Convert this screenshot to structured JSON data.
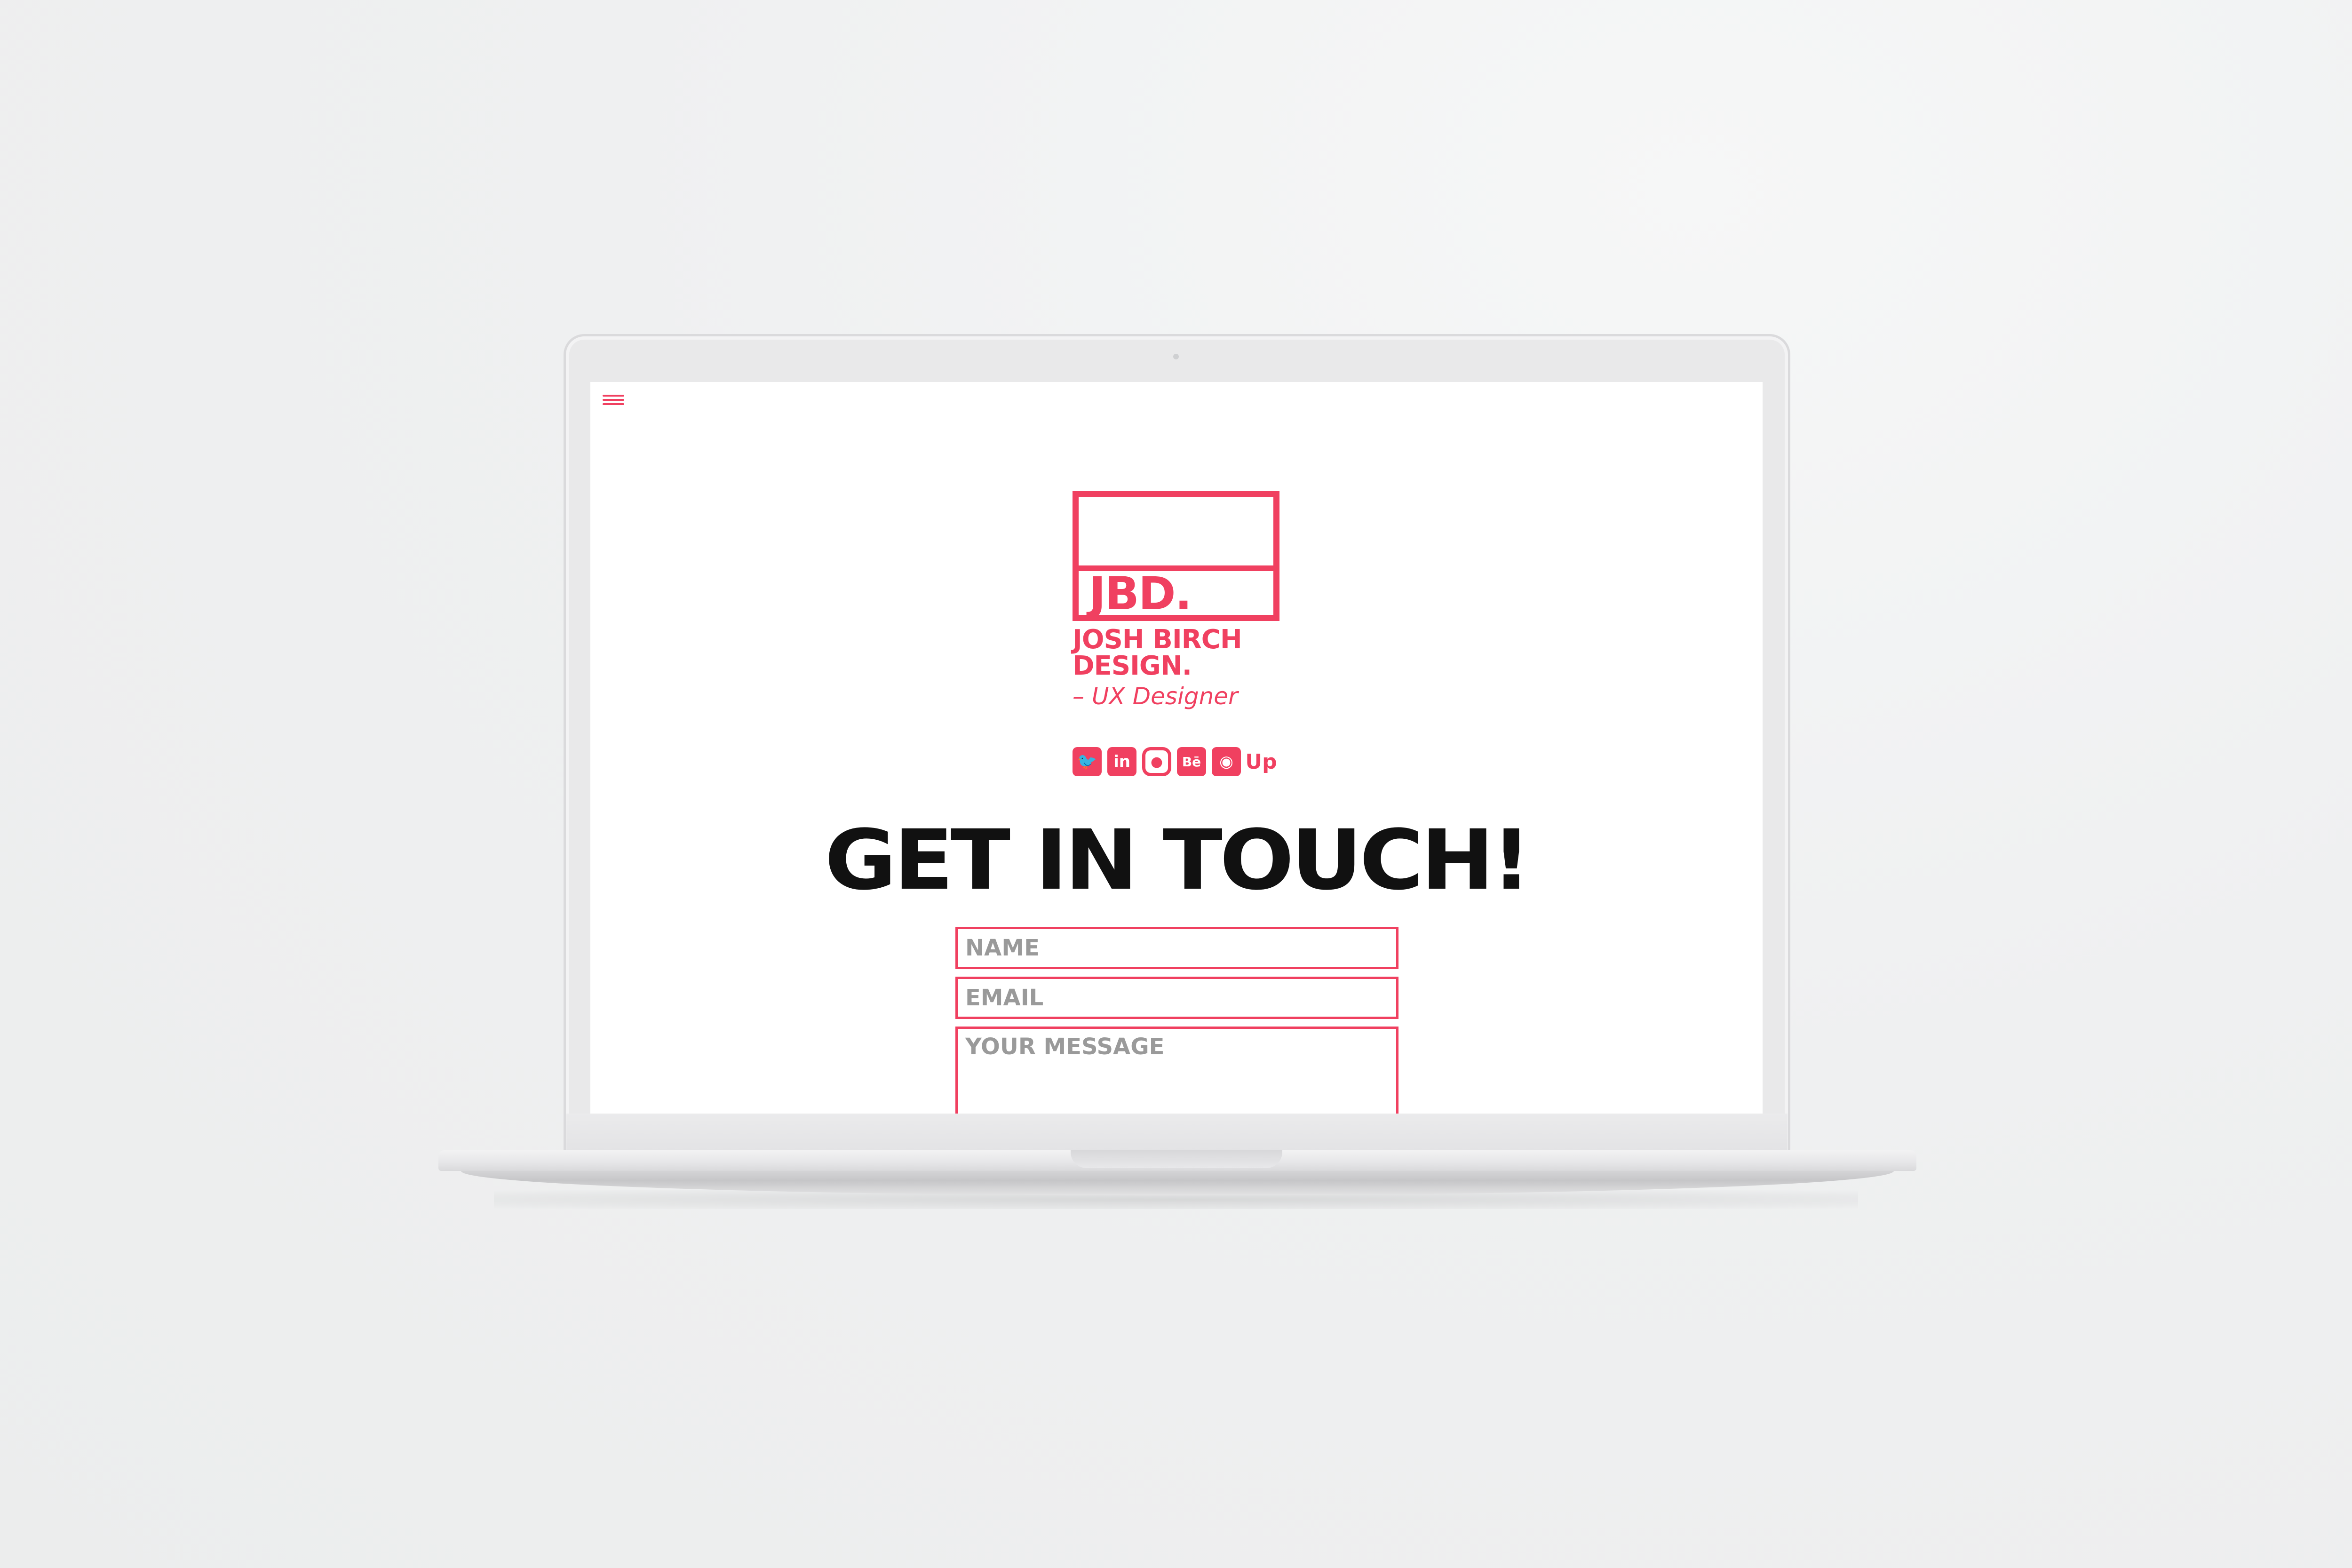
{
  "site": {
    "menu_icon": "hamburger-menu-icon",
    "logo": {
      "mark": "JBD.",
      "name_line1": "JOSH BIRCH",
      "name_line2": "DESIGN.",
      "tagline": "– UX Designer"
    },
    "social": [
      {
        "icon": "twitter-icon",
        "glyph": "🐦"
      },
      {
        "icon": "linkedin-icon",
        "glyph": "in"
      },
      {
        "icon": "instagram-icon",
        "glyph": "◎"
      },
      {
        "icon": "behance-icon",
        "glyph": "Bē"
      },
      {
        "icon": "github-icon",
        "glyph": "◉"
      },
      {
        "icon": "upwork-icon",
        "glyph": "Up"
      }
    ],
    "heading": "GET IN TOUCH!",
    "form": {
      "name_placeholder": "NAME",
      "email_placeholder": "EMAIL",
      "message_placeholder": "YOUR MESSAGE"
    }
  },
  "colors": {
    "accent": "#f04060",
    "heading": "#111111",
    "placeholder": "#9a9a9a"
  }
}
